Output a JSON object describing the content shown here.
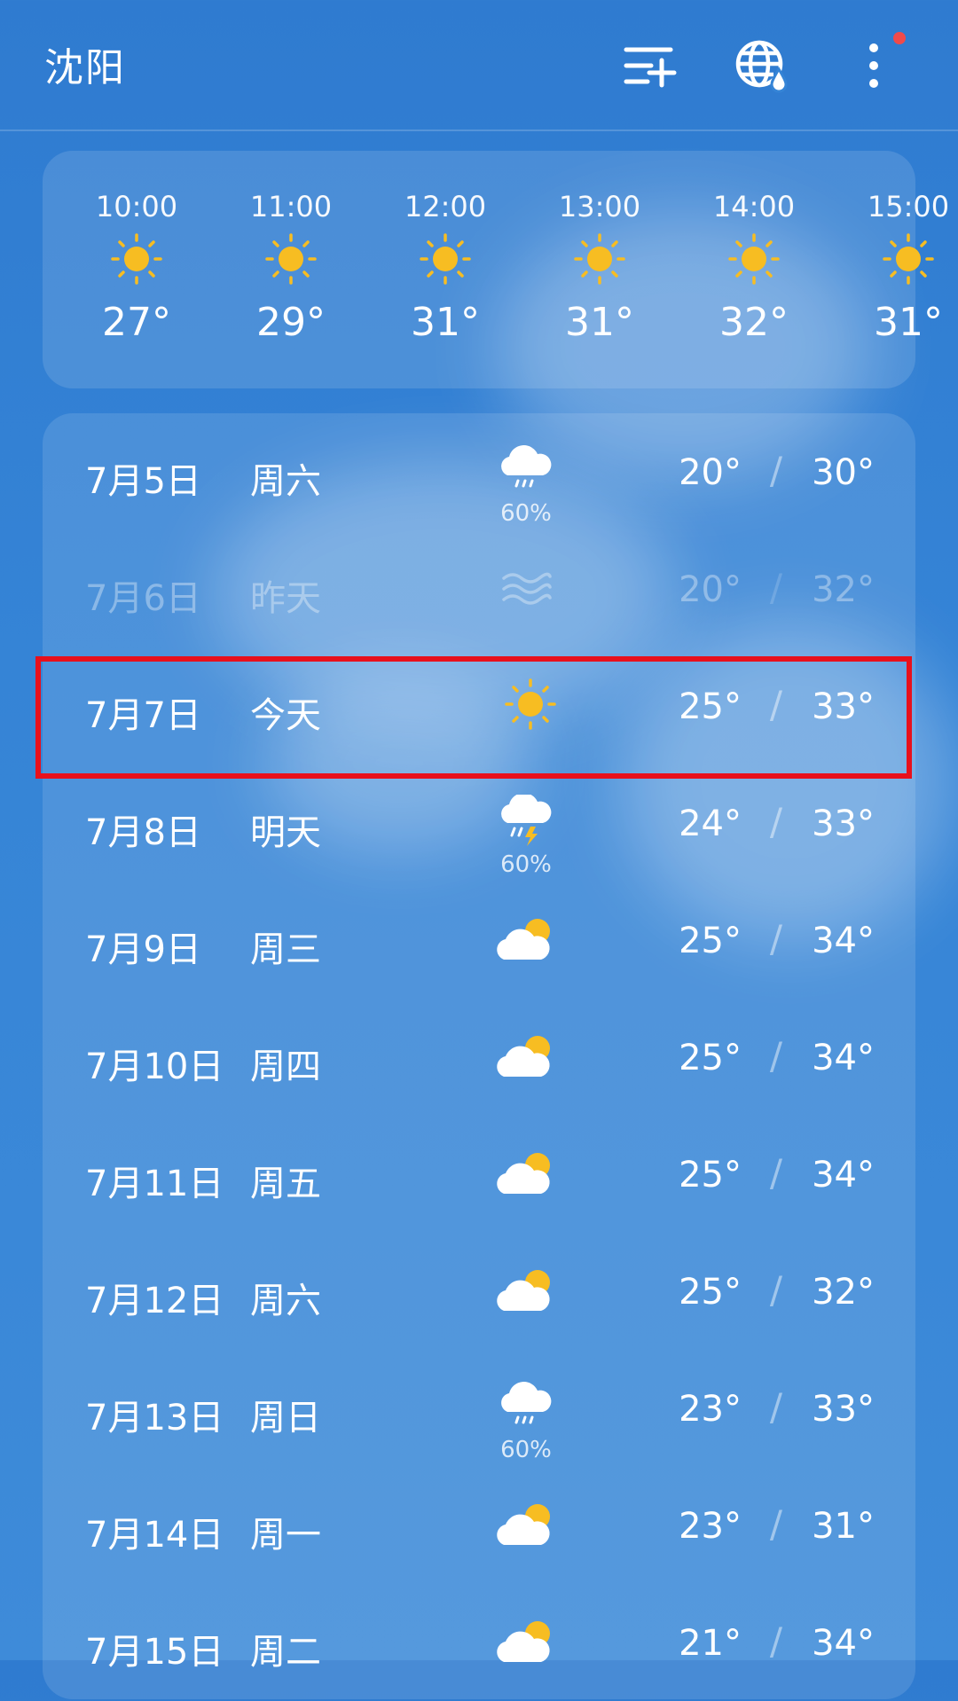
{
  "header": {
    "city": "沈阳"
  },
  "icons": {
    "list_add": "list-add-icon",
    "globe": "globe-rain-icon",
    "more": "more-vertical-icon"
  },
  "colors": {
    "sun": "#f7bd22",
    "cloud": "#ffffff",
    "highlight": "#e8101c",
    "notification_dot": "#f04a4a"
  },
  "hourly": [
    {
      "time": "10:00",
      "icon": "sun",
      "temp": "27°"
    },
    {
      "time": "11:00",
      "icon": "sun",
      "temp": "29°"
    },
    {
      "time": "12:00",
      "icon": "sun",
      "temp": "31°"
    },
    {
      "time": "13:00",
      "icon": "sun",
      "temp": "31°"
    },
    {
      "time": "14:00",
      "icon": "sun",
      "temp": "32°"
    },
    {
      "time": "15:00",
      "icon": "sun",
      "temp": "31°"
    }
  ],
  "daily": [
    {
      "date": "7月5日",
      "weekday": "周六",
      "icon": "light-rain",
      "precip": "60%",
      "low": "20°",
      "high": "30°"
    },
    {
      "date": "7月6日",
      "weekday": "昨天",
      "icon": "haze",
      "precip": "",
      "low": "20°",
      "high": "32°"
    },
    {
      "date": "7月7日",
      "weekday": "今天",
      "icon": "sun",
      "precip": "",
      "low": "25°",
      "high": "33°"
    },
    {
      "date": "7月8日",
      "weekday": "明天",
      "icon": "thunderstorm",
      "precip": "60%",
      "low": "24°",
      "high": "33°"
    },
    {
      "date": "7月9日",
      "weekday": "周三",
      "icon": "partly-cloudy",
      "precip": "",
      "low": "25°",
      "high": "34°"
    },
    {
      "date": "7月10日",
      "weekday": "周四",
      "icon": "partly-cloudy",
      "precip": "",
      "low": "25°",
      "high": "34°"
    },
    {
      "date": "7月11日",
      "weekday": "周五",
      "icon": "partly-cloudy",
      "precip": "",
      "low": "25°",
      "high": "34°"
    },
    {
      "date": "7月12日",
      "weekday": "周六",
      "icon": "partly-cloudy",
      "precip": "",
      "low": "25°",
      "high": "32°"
    },
    {
      "date": "7月13日",
      "weekday": "周日",
      "icon": "light-rain",
      "precip": "60%",
      "low": "23°",
      "high": "33°"
    },
    {
      "date": "7月14日",
      "weekday": "周一",
      "icon": "partly-cloudy",
      "precip": "",
      "low": "23°",
      "high": "31°"
    },
    {
      "date": "7月15日",
      "weekday": "周二",
      "icon": "partly-cloudy",
      "precip": "",
      "low": "21°",
      "high": "34°"
    }
  ],
  "separator": "/"
}
